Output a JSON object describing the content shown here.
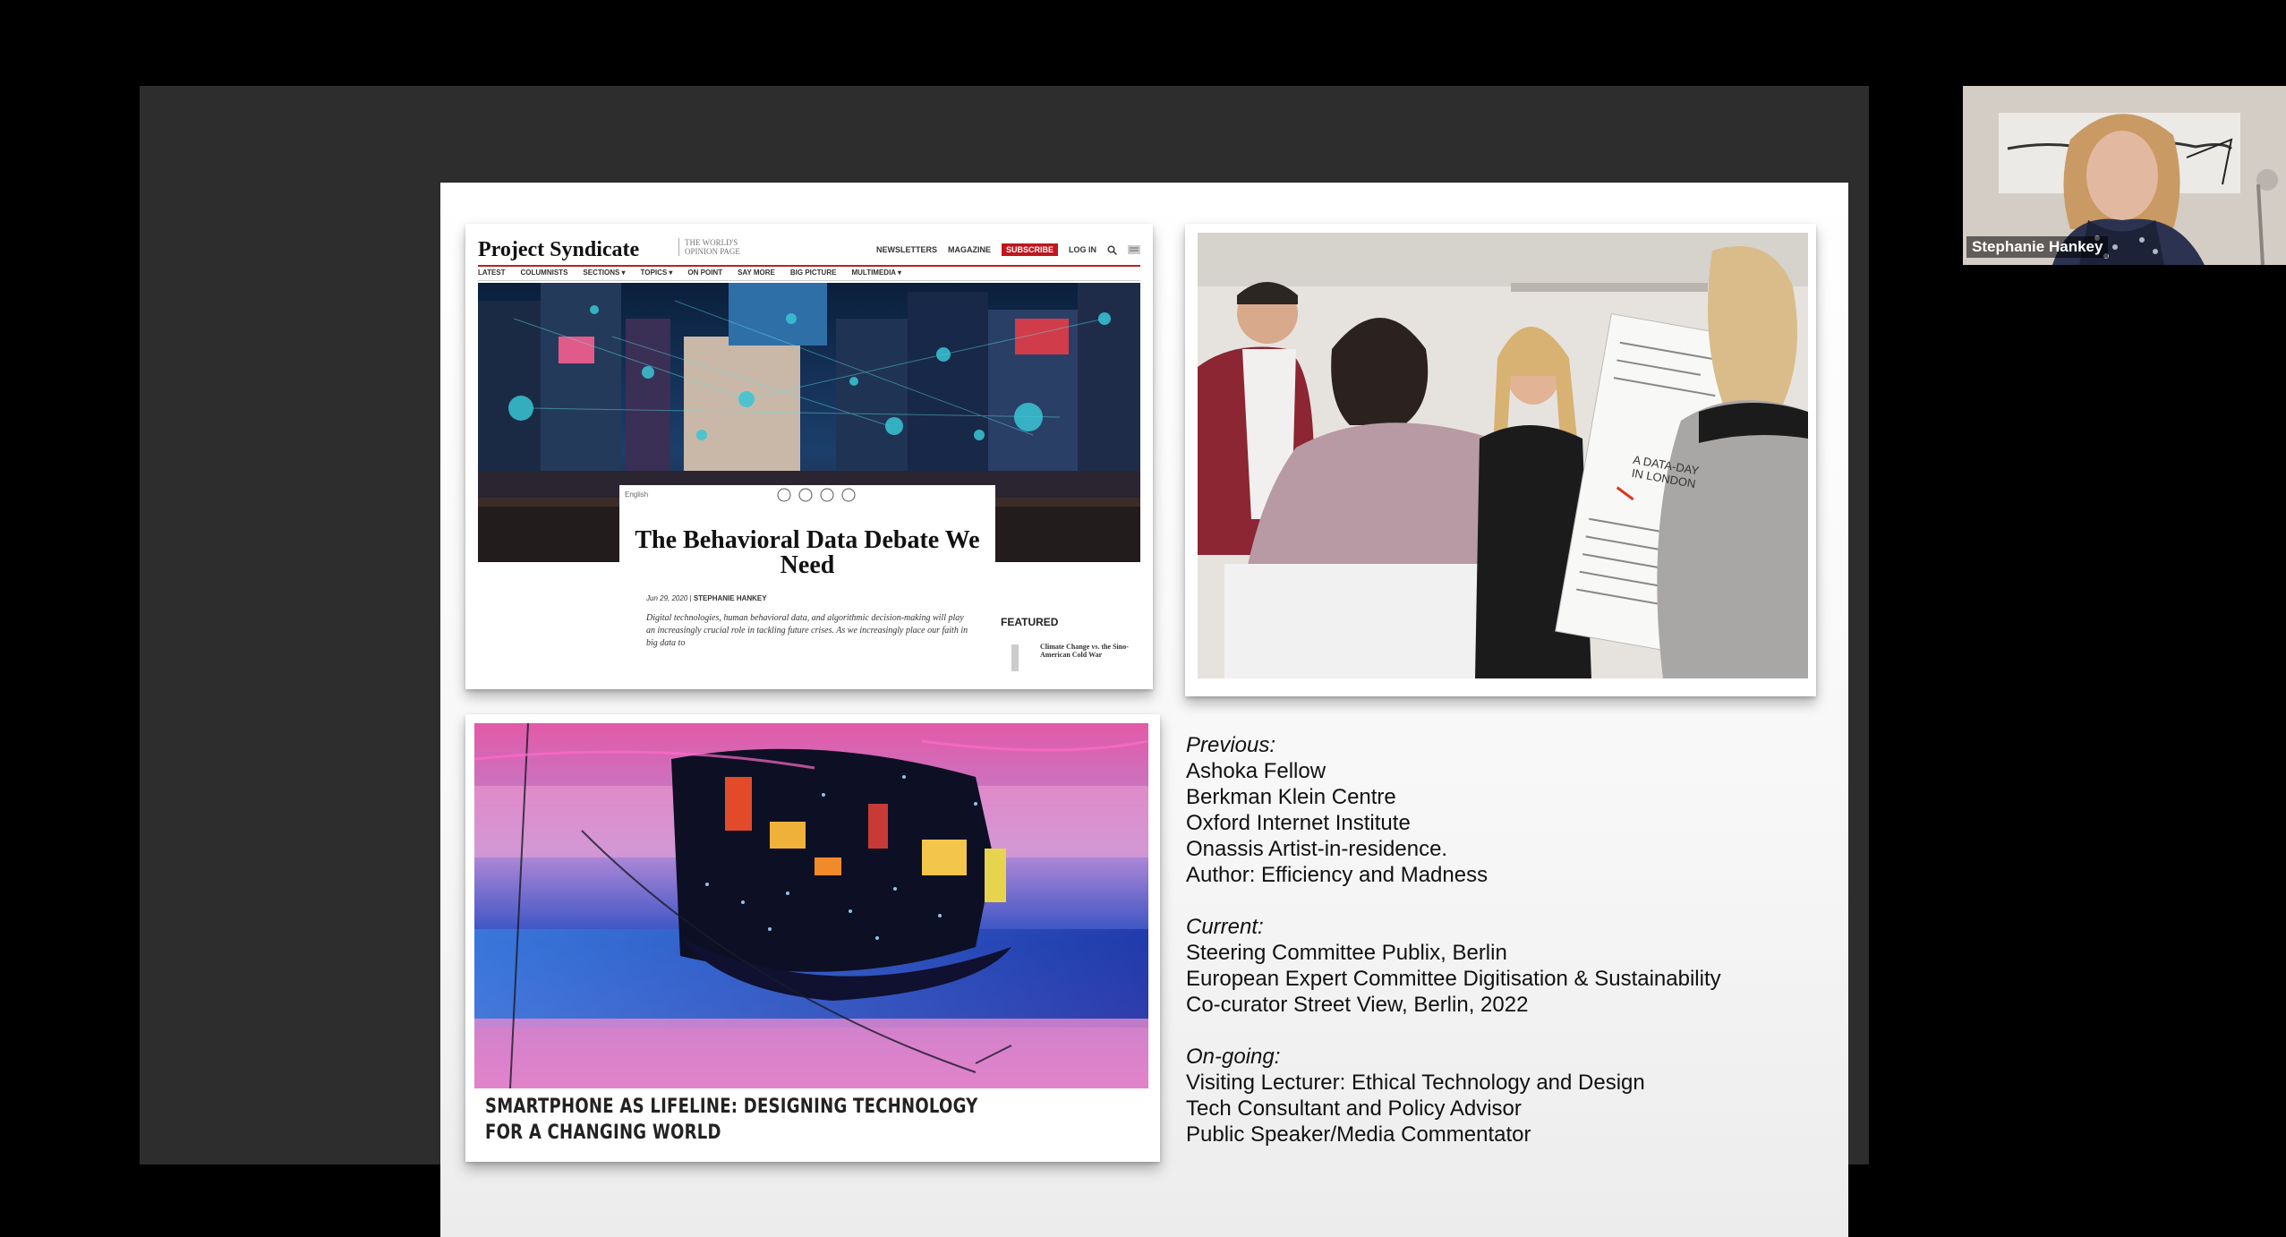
{
  "participant": {
    "name": "Stephanie Hankey"
  },
  "article": {
    "site_logo": "Project Syndicate",
    "tagline": "THE WORLD'S OPINION PAGE",
    "top_nav": [
      "NEWSLETTERS",
      "MAGAZINE",
      "SUBSCRIBE",
      "LOG IN"
    ],
    "main_nav": [
      "LATEST",
      "COLUMNISTS",
      "SECTIONS ▾",
      "TOPICS ▾",
      "ON POINT",
      "SAY MORE",
      "BIG PICTURE",
      "MULTIMEDIA ▾"
    ],
    "language": "English",
    "title": "The Behavioral Data Debate We Need",
    "date": "Jun 29, 2020",
    "author": "STEPHANIE HANKEY",
    "excerpt": "Digital technologies, human behavioral data, and algorithmic decision-making will play an increasingly crucial role in tackling future crises. As we increasingly place our faith in big data to",
    "featured_label": "FEATURED",
    "featured_item": "Climate Change vs. the Sino-American Cold War"
  },
  "photo": {
    "sign_text": "A DATA-DAY IN LONDON"
  },
  "art": {
    "caption": "SMARTPHONE AS LIFELINE: DESIGNING TECHNOLOGY FOR A CHANGING WORLD"
  },
  "bio": {
    "previous": {
      "heading": "Previous:",
      "items": [
        "Ashoka Fellow",
        "Berkman Klein Centre",
        "Oxford Internet Institute",
        "Onassis Artist-in-residence.",
        "Author: Efficiency and Madness"
      ]
    },
    "current": {
      "heading": "Current:",
      "items": [
        "Steering Committee Publix, Berlin",
        "European Expert Committee Digitisation & Sustainability",
        "Co-curator Street View, Berlin, 2022"
      ]
    },
    "ongoing": {
      "heading": "On-going:",
      "items": [
        "Visiting Lecturer: Ethical Technology and Design",
        "Tech Consultant and Policy Advisor",
        "Public Speaker/Media Commentator"
      ]
    }
  }
}
